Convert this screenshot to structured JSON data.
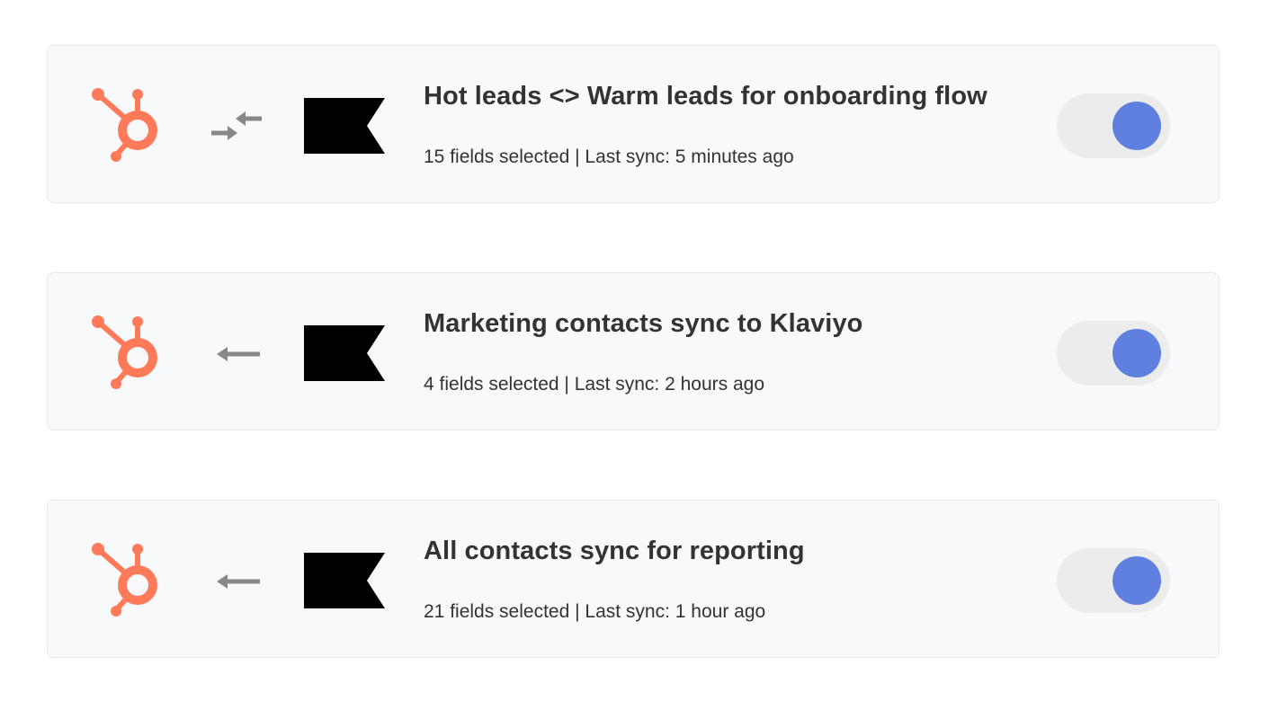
{
  "colors": {
    "hubspot_orange": "#ff7a59",
    "arrow_gray": "#888888",
    "toggle_on": "#6080e0",
    "card_bg": "#f8f9fb"
  },
  "syncs": [
    {
      "title": "Hot leads <> Warm leads for onboarding flow",
      "meta": "15 fields selected | Last sync: 5 minutes ago",
      "direction": "bidirectional",
      "direction_icon": "bidirectional-arrows-icon",
      "source_icon": "hubspot-logo-icon",
      "destination_icon": "klaviyo-flag-logo-icon",
      "enabled": true
    },
    {
      "title": "Marketing contacts sync to Klaviyo",
      "meta": "4 fields selected | Last sync: 2 hours ago",
      "direction": "left",
      "direction_icon": "arrow-left-icon",
      "source_icon": "hubspot-logo-icon",
      "destination_icon": "klaviyo-flag-logo-icon",
      "enabled": true
    },
    {
      "title": "All contacts sync for reporting",
      "meta": "21 fields selected | Last sync: 1 hour ago",
      "direction": "left",
      "direction_icon": "arrow-left-icon",
      "source_icon": "hubspot-logo-icon",
      "destination_icon": "klaviyo-flag-logo-icon",
      "enabled": true
    }
  ]
}
